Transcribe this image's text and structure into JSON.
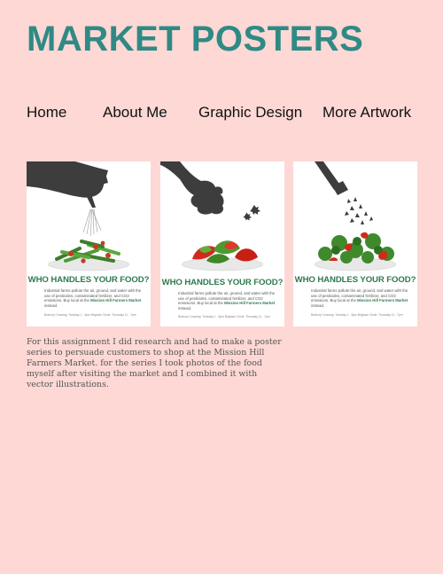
{
  "site": {
    "title": "MARKET POSTERS"
  },
  "nav": {
    "items": [
      {
        "label": "Home"
      },
      {
        "label": "About Me"
      },
      {
        "label": "Graphic Design"
      },
      {
        "label": "More Artwork"
      }
    ]
  },
  "posters": [
    {
      "headline": "WHO HANDLES YOUR FOOD?",
      "body_text": "Industrial farms pollute the air, ground, and water with the use of pesticides, contaminated fertilizer, and CO2 emissions. Buy local at the",
      "market_name": "Mission Hill Farmers Market",
      "body_end": "instead.",
      "footer": "Brabury Crossing: Tuesday 1 - 5pm     Brigham Circle: Thursday 11 - 7pm",
      "illustration": "hand-watering-can-icon",
      "food": "green-beans"
    },
    {
      "headline": "WHO HANDLES YOUR FOOD?",
      "body_text": "Industrial farms pollute the air, ground, and water with the use of pesticides, contaminated fertilizer, and CO2 emissions. Buy local at the",
      "market_name": "Mission Hill Farmers Market",
      "body_end": "instead.",
      "footer": "Brabury Crossing: Tuesday 1 - 5pm     Brigham Circle: Thursday 11 - 7pm",
      "illustration": "hand-spreader-icon",
      "food": "peppers"
    },
    {
      "headline": "WHO HANDLES YOUR FOOD?",
      "body_text": "Industrial farms pollute the air, ground, and water with the use of pesticides, contaminated fertilizer, and CO2 emissions. Buy local at the",
      "market_name": "Mission Hill Farmers Market",
      "body_end": "instead.",
      "footer": "Brabury Crossing: Tuesday 1 - 5pm     Brigham Circle: Thursday 11 - 7pm",
      "illustration": "spray-nozzle-icon",
      "food": "broccoli-peppers"
    }
  ],
  "description": "For this assignment I did research and had to make a poster series to persuade customers to shop at the Mission Hill Farmers Market. for the series I took photos of the food myself after visiting the market and I combined it with vector illustrations.",
  "colors": {
    "background": "#fdd8d5",
    "title": "#2f8a85",
    "poster_headline": "#2e7a4f",
    "illustration": "#3d3d3d"
  }
}
